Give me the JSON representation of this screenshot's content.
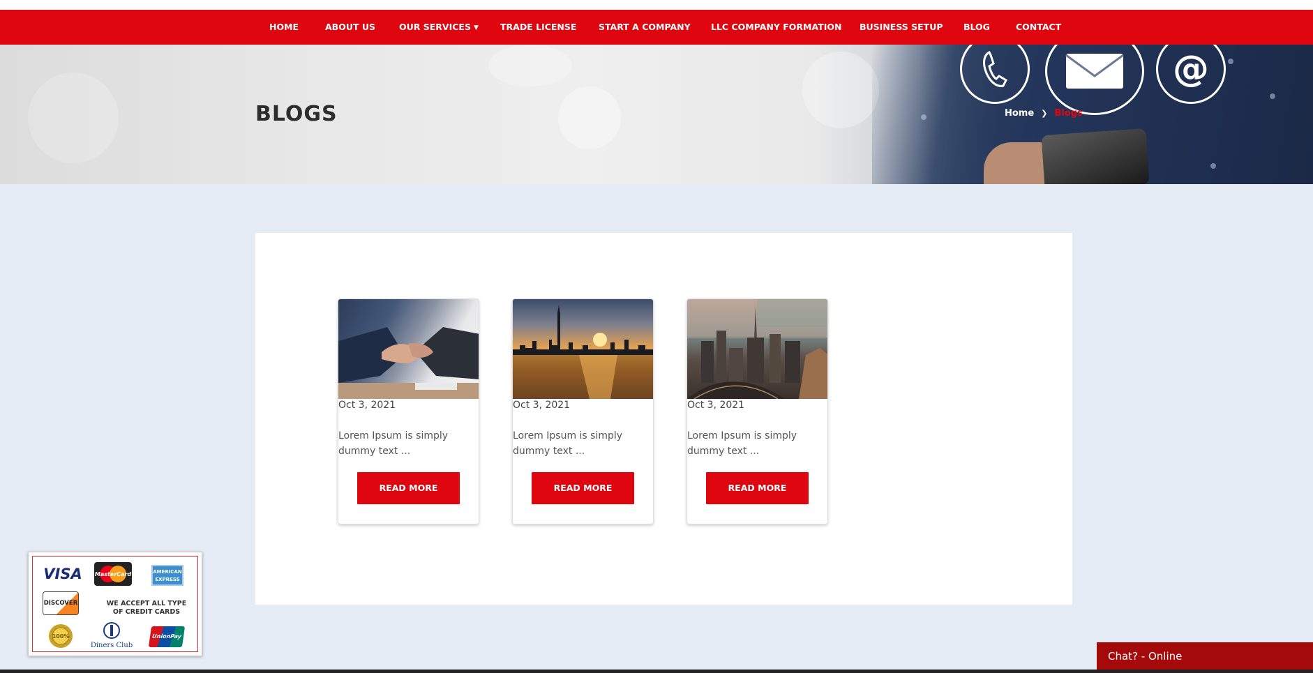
{
  "nav": {
    "items": [
      {
        "label": "HOME"
      },
      {
        "label": "ABOUT US"
      },
      {
        "label": "OUR SERVICES"
      },
      {
        "label": "TRADE LICENSE"
      },
      {
        "label": "START A COMPANY"
      },
      {
        "label": "LLC COMPANY FORMATION"
      },
      {
        "label": "BUSINESS SETUP"
      },
      {
        "label": "BLOG"
      },
      {
        "label": "CONTACT"
      }
    ],
    "accent": "#e0060f"
  },
  "hero": {
    "title": "BLOGS",
    "breadcrumb": {
      "home": "Home",
      "current": "Blogs"
    }
  },
  "posts": [
    {
      "date": "Oct 3, 2021",
      "excerpt": "Lorem Ipsum is simply dummy text ...",
      "button": "READ MORE"
    },
    {
      "date": "Oct 3, 2021",
      "excerpt": "Lorem Ipsum is simply dummy text ...",
      "button": "READ MORE"
    },
    {
      "date": "Oct 3, 2021",
      "excerpt": "Lorem Ipsum is simply dummy text ...",
      "button": "READ MORE"
    }
  ],
  "payment": {
    "visa": "VISA",
    "mastercard": "MasterCard",
    "amex": "AMERICAN EXPRESS",
    "discover": "DISCOVER",
    "accept_text": "WE ACCEPT ALL TYPE OF CREDIT CARDS",
    "diners": "Diners Club",
    "unionpay": "UnionPay"
  },
  "chat": {
    "label": "Chat? - Online"
  }
}
